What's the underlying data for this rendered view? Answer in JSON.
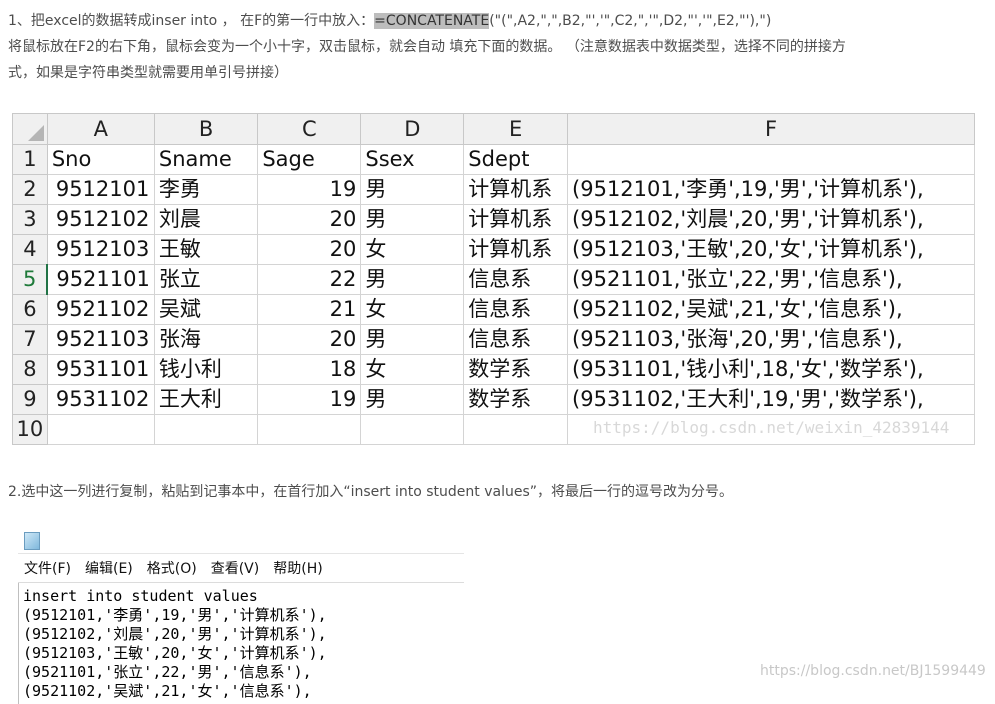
{
  "step1": {
    "prefix": "1、把excel的数据转成inser into ， 在F的第一行中放入：",
    "formula_highlight": "=CONCATENATE",
    "formula_rest": "(\"(\",A2,\",\",B2,\"','\",C2,\",'\",D2,\"','\",E2,\"'),\")",
    "line2": "将鼠标放在F2的右下角，鼠标会变为一个小十字，双击鼠标，就会自动 填充下面的数据。 （注意数据表中数据类型，选择不同的拼接方",
    "line3": "式，如果是字符串类型就需要用单引号拼接）"
  },
  "sheet": {
    "columns": [
      "A",
      "B",
      "C",
      "D",
      "E",
      "F"
    ],
    "row_numbers": [
      "1",
      "2",
      "3",
      "4",
      "5",
      "6",
      "7",
      "8",
      "9",
      "10"
    ],
    "header_row": [
      "Sno",
      "Sname",
      "Sage",
      "Ssex",
      "Sdept",
      ""
    ],
    "rows": [
      [
        "9512101",
        "李勇",
        "19",
        "男",
        "计算机系",
        "(9512101,'李勇',19,'男','计算机系'),"
      ],
      [
        "9512102",
        "刘晨",
        "20",
        "男",
        "计算机系",
        "(9512102,'刘晨',20,'男','计算机系'),"
      ],
      [
        "9512103",
        "王敏",
        "20",
        "女",
        "计算机系",
        "(9512103,'王敏',20,'女','计算机系'),"
      ],
      [
        "9521101",
        "张立",
        "22",
        "男",
        "信息系",
        "(9521101,'张立',22,'男','信息系'),"
      ],
      [
        "9521102",
        "吴斌",
        "21",
        "女",
        "信息系",
        "(9521102,'吴斌',21,'女','信息系'),"
      ],
      [
        "9521103",
        "张海",
        "20",
        "男",
        "信息系",
        "(9521103,'张海',20,'男','信息系'),"
      ],
      [
        "9531101",
        "钱小利",
        "18",
        "女",
        "数学系",
        "(9531101,'钱小利',18,'女','数学系'),"
      ],
      [
        "9531102",
        "王大利",
        "19",
        "男",
        "数学系",
        "(9531102,'王大利',19,'男','数学系'),"
      ]
    ],
    "watermark": "https://blog.csdn.net/weixin_42839144"
  },
  "step2": {
    "text": "2.选中这一列进行复制，粘贴到记事本中，在首行加入“insert into student values”，将最后一行的逗号改为分号。"
  },
  "notepad": {
    "menu": [
      "文件(F)",
      "编辑(E)",
      "格式(O)",
      "查看(V)",
      "帮助(H)"
    ],
    "lines": [
      "insert into student values",
      "(9512101,'李勇',19,'男','计算机系'),",
      "(9512102,'刘晨',20,'男','计算机系'),",
      "(9512103,'王敏',20,'女','计算机系'),",
      "(9521101,'张立',22,'男','信息系'),",
      "(9521102,'吴斌',21,'女','信息系'),"
    ]
  },
  "watermark2": "https://blog.csdn.net/BJ1599449"
}
